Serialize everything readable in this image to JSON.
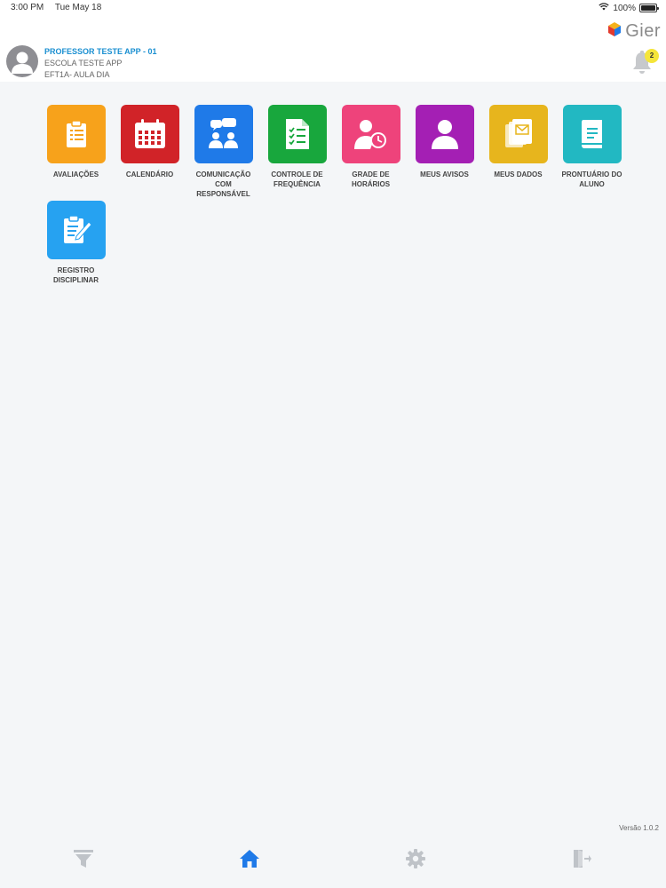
{
  "status_bar": {
    "time": "3:00 PM",
    "date": "Tue May 18",
    "battery": "100%",
    "battery_level": 1.0
  },
  "header": {
    "user_name": "PROFESSOR TESTE APP - 01",
    "school": "ESCOLA TESTE APP",
    "class_name": "EFT1A- AULA DIA",
    "logo_text": "Gier",
    "notification_count": "2"
  },
  "menu": [
    {
      "label_line1": "AVALIAÇÕES",
      "label_line2": "",
      "color": "#f7a21b",
      "icon": "clipboard-list-icon"
    },
    {
      "label_line1": "CALENDÁRIO",
      "label_line2": "",
      "color": "#d12328",
      "icon": "calendar-icon"
    },
    {
      "label_line1": "COMUNICAÇÃO",
      "label_line2": "COM RESPONSÁVEL",
      "color": "#1f7ae8",
      "icon": "chat-people-icon"
    },
    {
      "label_line1": "CONTROLE DE",
      "label_line2": "FREQUÊNCIA",
      "color": "#18a73d",
      "icon": "checklist-icon"
    },
    {
      "label_line1": "GRADE DE",
      "label_line2": "HORÁRIOS",
      "color": "#ee437b",
      "icon": "person-clock-icon"
    },
    {
      "label_line1": "MEUS AVISOS",
      "label_line2": "",
      "color": "#a41fb4",
      "icon": "person-icon"
    },
    {
      "label_line1": "MEUS DADOS",
      "label_line2": "",
      "color": "#e7b51d",
      "icon": "documents-icon"
    },
    {
      "label_line1": "PRONTUÁRIO DO",
      "label_line2": "ALUNO",
      "color": "#22b8c2",
      "icon": "book-icon"
    },
    {
      "label_line1": "REGISTRO",
      "label_line2": "DISCIPLINAR",
      "color": "#26a2f1",
      "icon": "clipboard-pen-icon"
    }
  ],
  "footer": {
    "version": "Versão 1.0.2"
  },
  "tabbar": {
    "active": "home",
    "active_color": "#1f7ae8",
    "inactive_color": "#bfc3c8"
  }
}
